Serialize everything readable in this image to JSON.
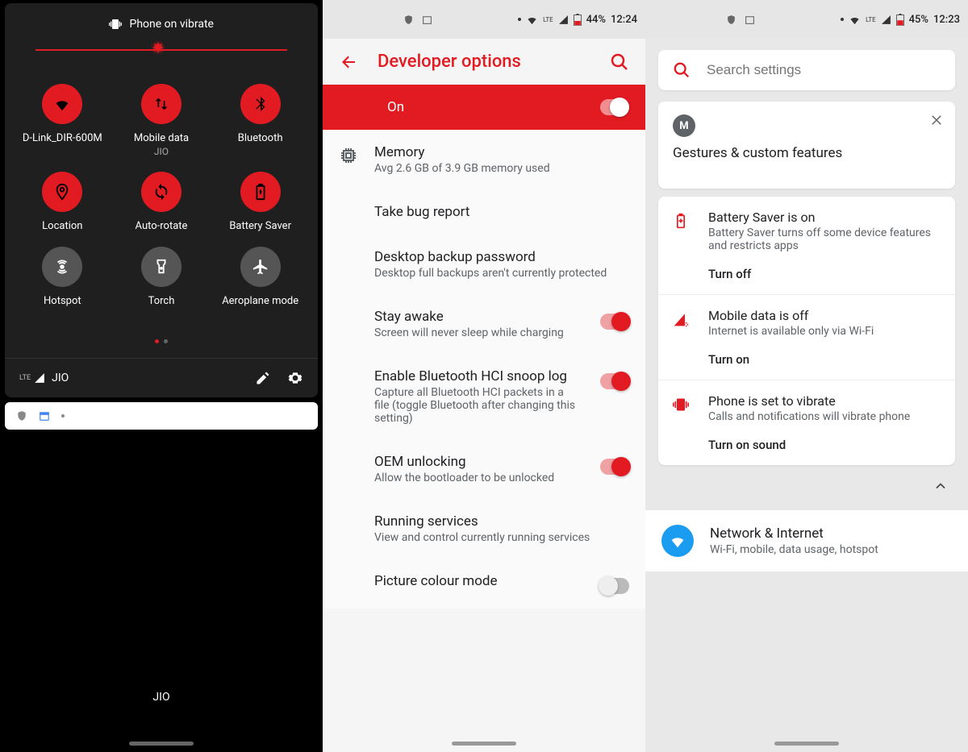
{
  "panel1": {
    "vibrate_text": "Phone on vibrate",
    "brightness_pct": 47,
    "tiles": [
      {
        "label": "D-Link_DIR-600M",
        "sub": "",
        "icon": "wifi",
        "active": true
      },
      {
        "label": "Mobile data",
        "sub": "JIO",
        "icon": "data",
        "active": true
      },
      {
        "label": "Bluetooth",
        "sub": "",
        "icon": "bluetooth",
        "active": true
      },
      {
        "label": "Location",
        "sub": "",
        "icon": "location",
        "active": true
      },
      {
        "label": "Auto-rotate",
        "sub": "",
        "icon": "rotate",
        "active": true
      },
      {
        "label": "Battery Saver",
        "sub": "",
        "icon": "battery",
        "active": true
      },
      {
        "label": "Hotspot",
        "sub": "",
        "icon": "hotspot",
        "active": false
      },
      {
        "label": "Torch",
        "sub": "",
        "icon": "torch",
        "active": false
      },
      {
        "label": "Aeroplane mode",
        "sub": "",
        "icon": "airplane",
        "active": false
      }
    ],
    "footer_carrier": "JIO",
    "footer_lte": "LTE",
    "bottom_carrier": "JIO"
  },
  "panel2": {
    "status": {
      "network": "LTE",
      "battery": "44%",
      "time": "12:24"
    },
    "title": "Developer options",
    "on_label": "On",
    "items": [
      {
        "label": "Memory",
        "sub": "Avg 2.6 GB of 3.9 GB memory used",
        "icon": true,
        "toggle": false
      },
      {
        "label": "Take bug report",
        "sub": "",
        "icon": false,
        "toggle": false
      },
      {
        "label": "Desktop backup password",
        "sub": "Desktop full backups aren't currently protected",
        "icon": false,
        "toggle": false
      },
      {
        "label": "Stay awake",
        "sub": "Screen will never sleep while charging",
        "icon": false,
        "toggle": true,
        "on": true
      },
      {
        "label": "Enable Bluetooth HCI snoop log",
        "sub": "Capture all Bluetooth HCI packets in a file (toggle Bluetooth after changing this setting)",
        "icon": false,
        "toggle": true,
        "on": true
      },
      {
        "label": "OEM unlocking",
        "sub": "Allow the bootloader to be unlocked",
        "icon": false,
        "toggle": true,
        "on": true
      },
      {
        "label": "Running services",
        "sub": "View and control currently running services",
        "icon": false,
        "toggle": false
      },
      {
        "label": "Picture colour mode",
        "sub": "",
        "icon": false,
        "toggle": true,
        "on": false
      }
    ]
  },
  "panel3": {
    "status": {
      "network": "LTE",
      "battery": "45%",
      "time": "12:23"
    },
    "search_placeholder": "Search settings",
    "gestures_title": "Gestures & custom features",
    "suggestions": [
      {
        "icon": "battery",
        "label": "Battery Saver is on",
        "sub": "Battery Saver turns off some device features and restricts apps",
        "action": "Turn off",
        "color": "#e21b22"
      },
      {
        "icon": "signal-off",
        "label": "Mobile data is off",
        "sub": "Internet is available only via Wi-Fi",
        "action": "Turn on",
        "color": "#e21b22"
      },
      {
        "icon": "vibrate",
        "label": "Phone is set to vibrate",
        "sub": "Calls and notifications will vibrate phone",
        "action": "Turn on sound",
        "color": "#e21b22"
      }
    ],
    "network": {
      "label": "Network & Internet",
      "sub": "Wi-Fi, mobile, data usage, hotspot"
    }
  }
}
